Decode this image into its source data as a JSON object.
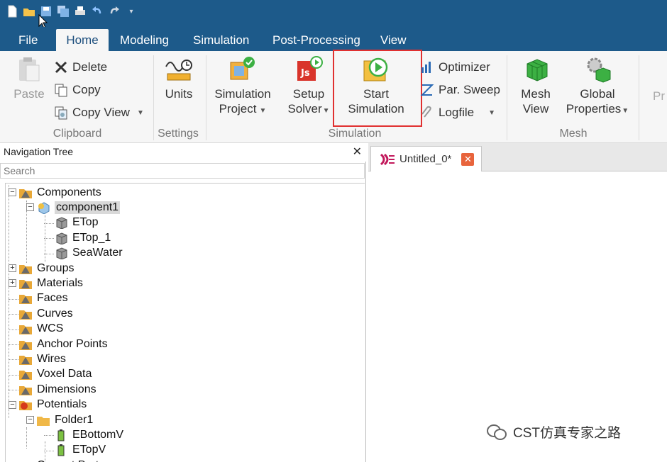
{
  "ribbon_tabs": [
    "File",
    "Home",
    "Modeling",
    "Simulation",
    "Post-Processing",
    "View"
  ],
  "active_tab": "Home",
  "clipboard": {
    "paste": "Paste",
    "delete": "Delete",
    "copy": "Copy",
    "copy_view": "Copy View",
    "label": "Clipboard"
  },
  "settings": {
    "units": "Units",
    "label": "Settings"
  },
  "simulation": {
    "sim_project_l1": "Simulation",
    "sim_project_l2": "Project",
    "setup_solver_l1": "Setup",
    "setup_solver_l2": "Solver",
    "start_sim_l1": "Start",
    "start_sim_l2": "Simulation",
    "optimizer": "Optimizer",
    "par_sweep": "Par. Sweep",
    "logfile": "Logfile",
    "label": "Simulation"
  },
  "mesh": {
    "mesh_view_l1": "Mesh",
    "mesh_view_l2": "View",
    "global_props_l1": "Global",
    "global_props_l2": "Properties",
    "label": "Mesh",
    "partial": "Pr"
  },
  "nav": {
    "title": "Navigation Tree",
    "close": "✕",
    "search_placeholder": "Search",
    "items": [
      "Components",
      "component1",
      "ETop",
      "ETop_1",
      "SeaWater",
      "Groups",
      "Materials",
      "Faces",
      "Curves",
      "WCS",
      "Anchor Points",
      "Wires",
      "Voxel Data",
      "Dimensions",
      "Potentials",
      "Folder1",
      "EBottomV",
      "ETopV",
      "Current Ports"
    ]
  },
  "document": {
    "tab_title": "Untitled_0*",
    "close": "✕"
  },
  "watermark": "CST仿真专家之路",
  "colors": {
    "titlebar": "#1d5a8a",
    "highlight": "#e03030"
  }
}
